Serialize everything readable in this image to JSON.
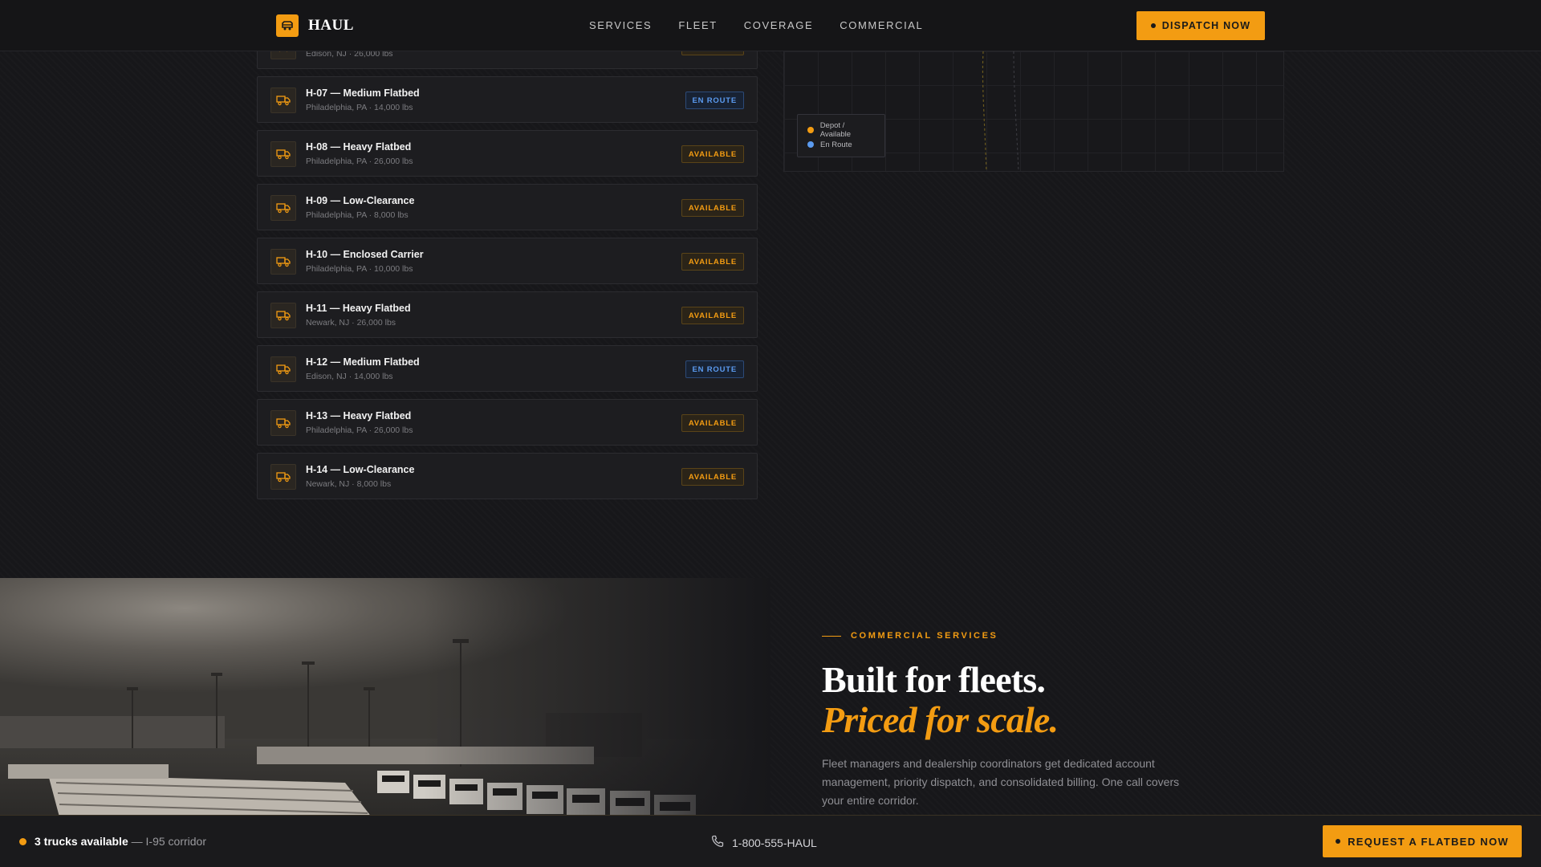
{
  "header": {
    "logo_text": "HAUL",
    "nav": [
      "SERVICES",
      "FLEET",
      "COVERAGE",
      "COMMERCIAL"
    ],
    "dispatch_label": "DISPATCH NOW"
  },
  "fleet": {
    "trucks": [
      {
        "name": "",
        "meta": "Edison, NJ · 26,000 lbs",
        "status": "AVAILABLE",
        "status_type": "available"
      },
      {
        "name": "H-07 — Medium Flatbed",
        "meta": "Philadelphia, PA · 14,000 lbs",
        "status": "EN ROUTE",
        "status_type": "enroute"
      },
      {
        "name": "H-08 — Heavy Flatbed",
        "meta": "Philadelphia, PA · 26,000 lbs",
        "status": "AVAILABLE",
        "status_type": "available"
      },
      {
        "name": "H-09 — Low-Clearance",
        "meta": "Philadelphia, PA · 8,000 lbs",
        "status": "AVAILABLE",
        "status_type": "available"
      },
      {
        "name": "H-10 — Enclosed Carrier",
        "meta": "Philadelphia, PA · 10,000 lbs",
        "status": "AVAILABLE",
        "status_type": "available"
      },
      {
        "name": "H-11 — Heavy Flatbed",
        "meta": "Newark, NJ · 26,000 lbs",
        "status": "AVAILABLE",
        "status_type": "available"
      },
      {
        "name": "H-12 — Medium Flatbed",
        "meta": "Edison, NJ · 14,000 lbs",
        "status": "EN ROUTE",
        "status_type": "enroute"
      },
      {
        "name": "H-13 — Heavy Flatbed",
        "meta": "Philadelphia, PA · 26,000 lbs",
        "status": "AVAILABLE",
        "status_type": "available"
      },
      {
        "name": "H-14 — Low-Clearance",
        "meta": "Newark, NJ · 8,000 lbs",
        "status": "AVAILABLE",
        "status_type": "available"
      }
    ]
  },
  "map": {
    "legend": [
      {
        "label": "Depot / Available",
        "color": "#f39c12"
      },
      {
        "label": "En Route",
        "color": "#5b9bf0"
      }
    ]
  },
  "commercial": {
    "label": "COMMERCIAL SERVICES",
    "headline_1": "Built for fleets.",
    "headline_2": "Priced for scale.",
    "body": "Fleet managers and dealership coordinators get dedicated account management, priority dispatch, and consolidated billing. One call covers your entire corridor."
  },
  "bottom_bar": {
    "availability_strong": "3 trucks available",
    "availability_rest": "— I-95 corridor",
    "phone": "1-800-555-HAUL",
    "request_label": "REQUEST A FLATBED NOW"
  },
  "colors": {
    "accent": "#f39c12",
    "enroute": "#5b9bf0",
    "background": "#17171a"
  }
}
